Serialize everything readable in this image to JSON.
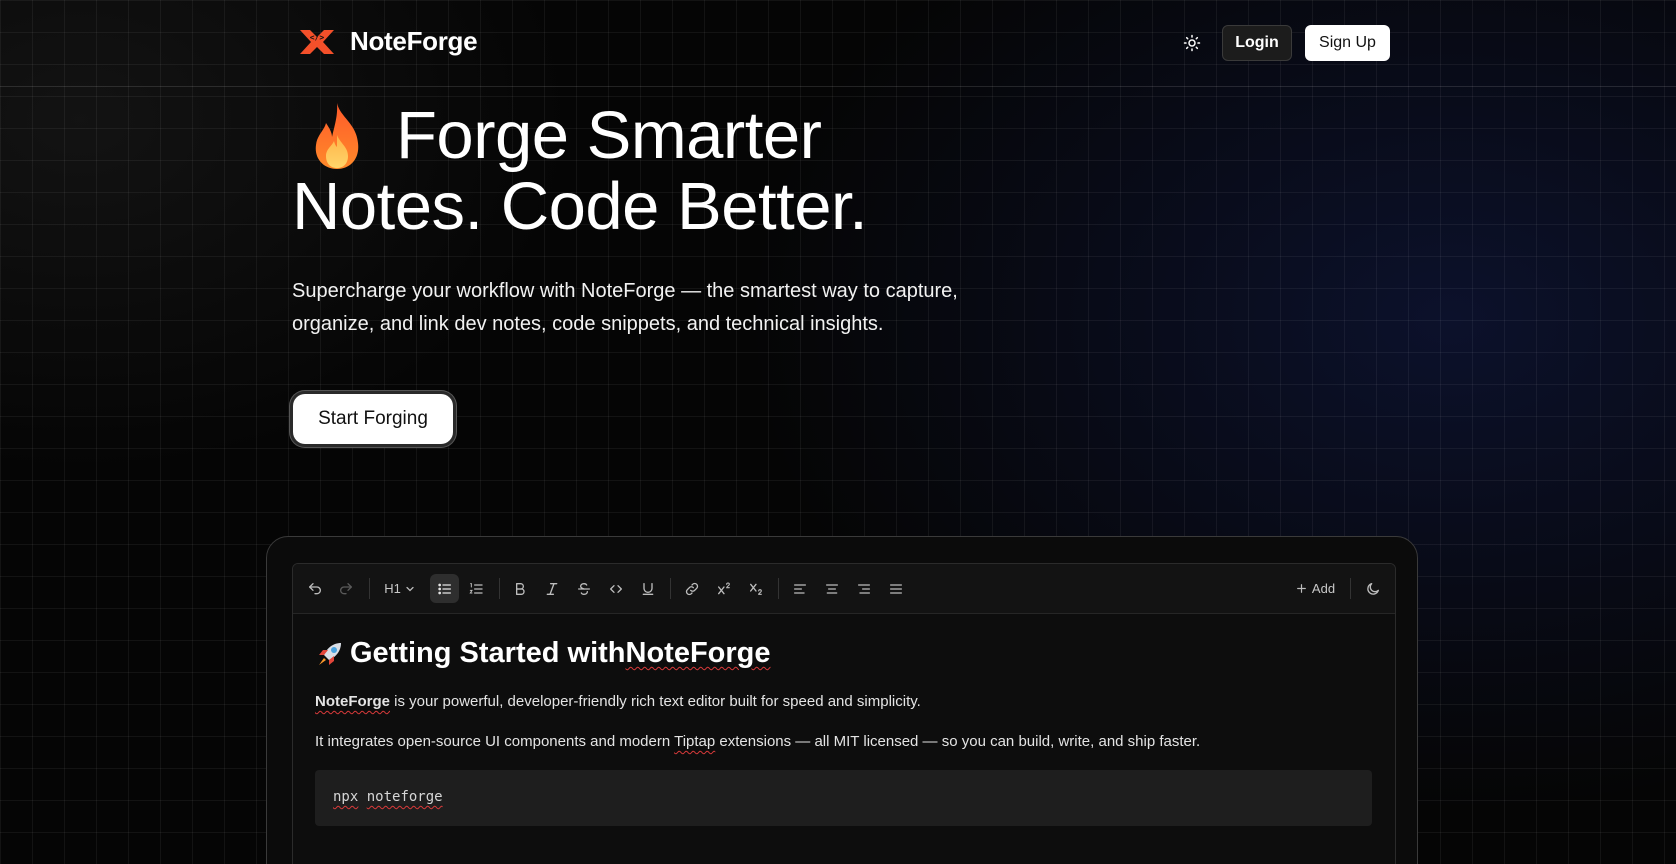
{
  "brand": {
    "name": "NoteForge",
    "logo_icon": "code-anvil-icon",
    "accent": "#f4502a"
  },
  "header": {
    "theme_icon": "sun-icon",
    "login_label": "Login",
    "signup_label": "Sign Up"
  },
  "hero": {
    "emoji_icon": "fire-icon",
    "title_line1": "Forge Smarter",
    "title_line2": "Notes. Code Better.",
    "subtitle_line1": "Supercharge your workflow with NoteForge — the smartest way to capture,",
    "subtitle_line2": "organize, and link dev notes, code snippets, and technical insights.",
    "cta_label": "Start Forging"
  },
  "editor": {
    "toolbar": {
      "heading_select": "H1",
      "add_label": "Add",
      "items": [
        "undo-icon",
        "redo-icon",
        "heading-select",
        "bullet-list-icon",
        "ordered-list-icon",
        "bold-icon",
        "italic-icon",
        "strikethrough-icon",
        "code-icon",
        "underline-icon",
        "link-icon",
        "superscript-icon",
        "subscript-icon",
        "align-left-icon",
        "align-center-icon",
        "align-right-icon",
        "align-justify-icon",
        "add-button",
        "moon-icon"
      ],
      "active_item": "bullet-list-icon"
    },
    "document": {
      "title_prefix": "Getting Started with ",
      "title_brand": "NoteForge",
      "p1_bold": "NoteForge",
      "p1_rest": " is your powerful, developer-friendly rich text editor built for speed and simplicity.",
      "p2_before": "It integrates open-source UI components and modern ",
      "p2_misspelled": "Tiptap",
      "p2_after": " extensions — all MIT licensed — so you can build, write, and ship faster.",
      "code_cmd": "npx",
      "code_arg": "noteforge"
    }
  },
  "colors": {
    "background": "#050505",
    "spellcheck": "#d93a3a"
  }
}
